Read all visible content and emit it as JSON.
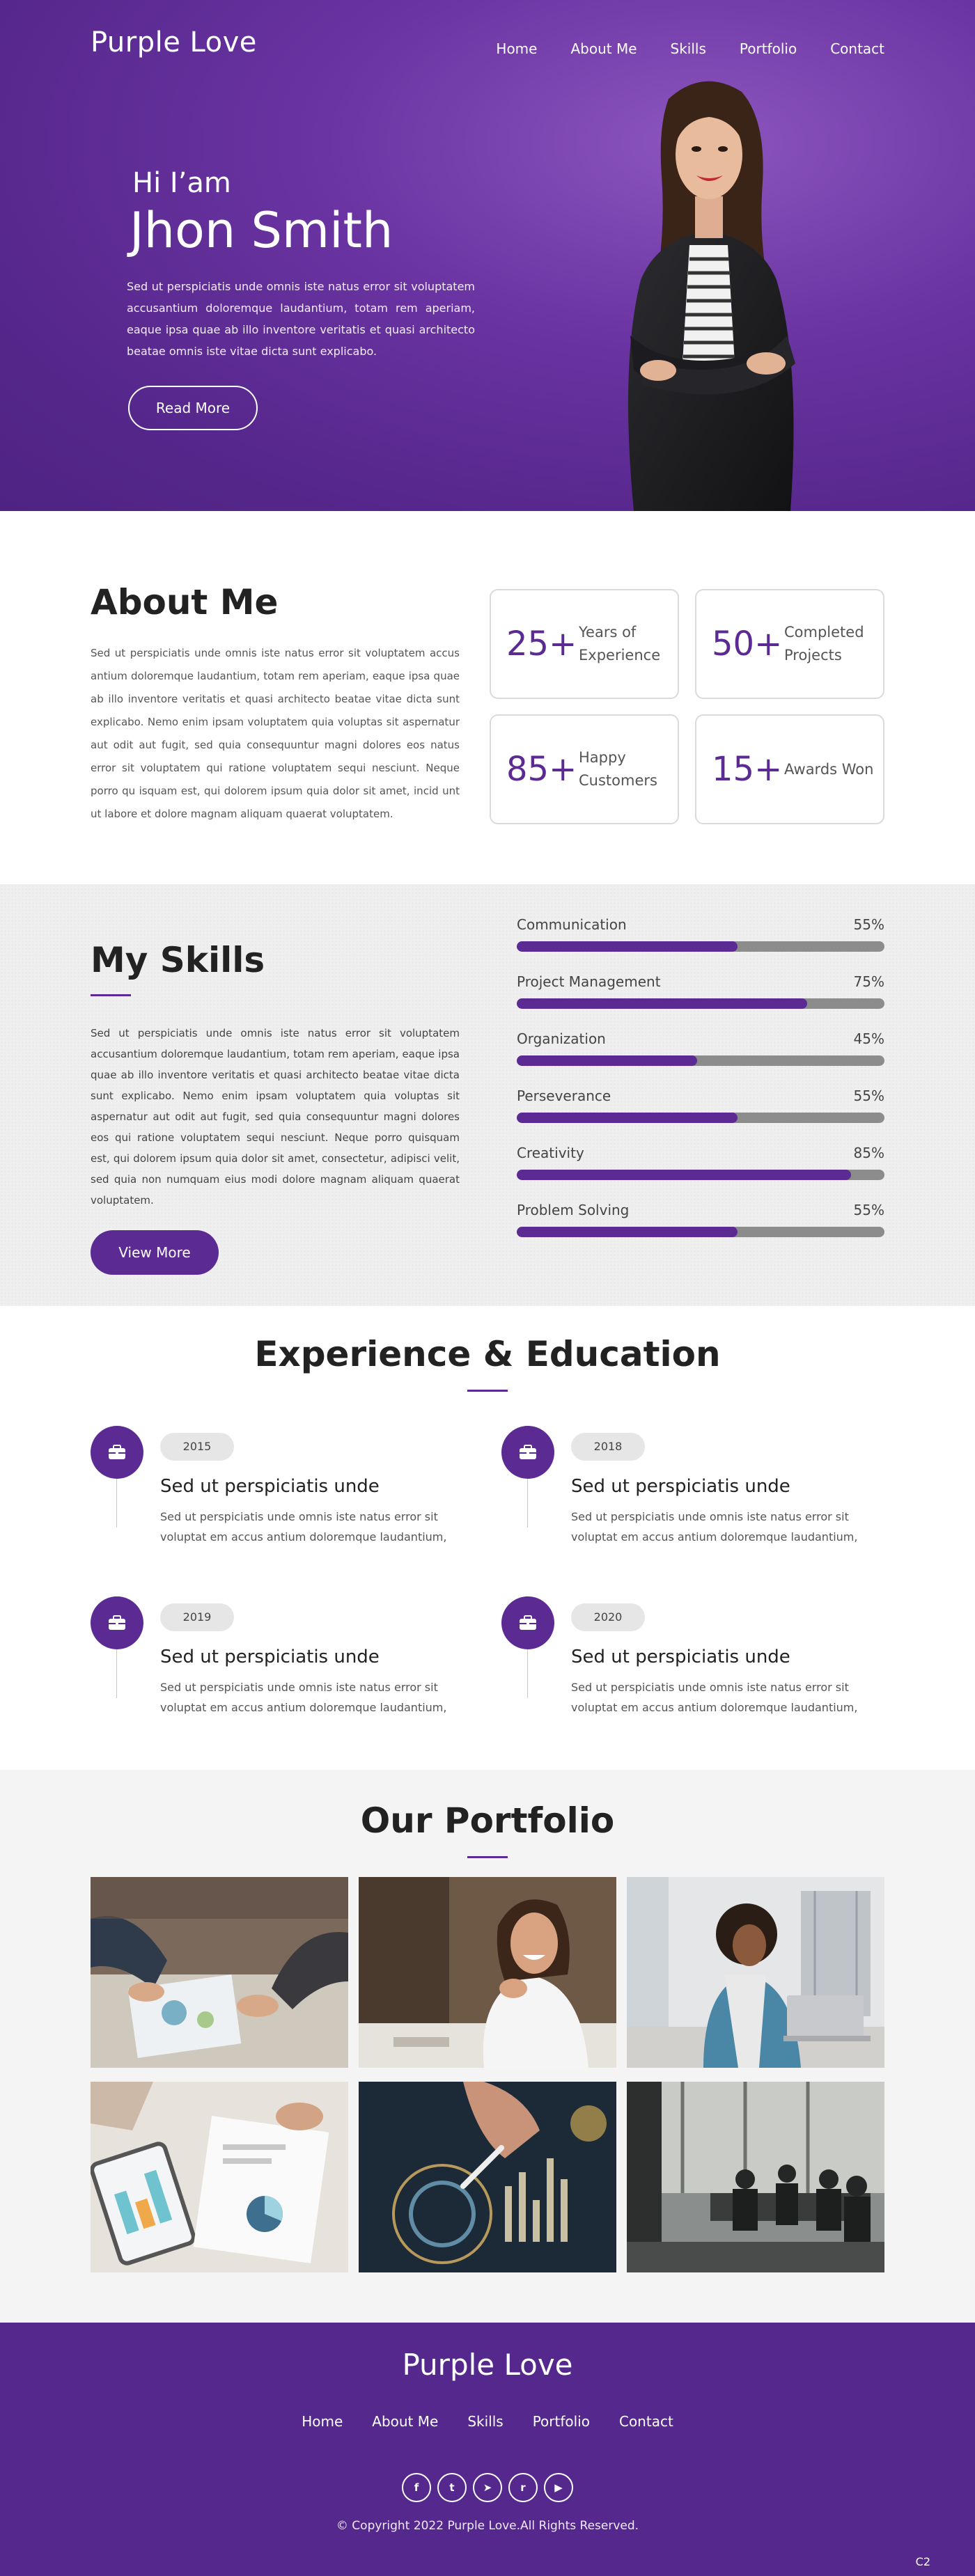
{
  "brand": {
    "name": "Purple Love"
  },
  "nav": {
    "items": [
      {
        "label": "Home"
      },
      {
        "label": "About Me"
      },
      {
        "label": "Skills"
      },
      {
        "label": "Portfolio"
      },
      {
        "label": "Contact"
      }
    ]
  },
  "hero": {
    "greeting": "Hi I’am",
    "name": "Jhon Smith",
    "description": "Sed ut perspiciatis unde omnis iste natus error sit voluptatem accusantium doloremque laudantium, totam rem aperiam, eaque ipsa quae ab illo inventore veritatis et quasi architecto beatae omnis iste  vitae dicta sunt explicabo.",
    "button_label": "Read More"
  },
  "about": {
    "title": "About Me",
    "description": "Sed ut perspiciatis unde omnis iste natus error sit voluptatem accus antium doloremque laudantium, totam rem aperiam, eaque ipsa quae ab illo inventore veritatis et quasi architecto beatae vitae dicta sunt explicabo. Nemo enim ipsam voluptatem quia voluptas sit aspernatur aut odit aut fugit, sed quia consequuntur magni dolores eos natus error sit voluptatem qui ratione voluptatem sequi nesciunt. Neque porro qu isquam est, qui dolorem ipsum quia dolor sit amet,  incid unt ut labore et dolore magnam aliquam quaerat voluptatem.",
    "stats": [
      {
        "value": "25+",
        "label": "Years of Experience"
      },
      {
        "value": "50+",
        "label": "Completed Projects"
      },
      {
        "value": "85+",
        "label": "Happy Customers"
      },
      {
        "value": "15+",
        "label": "Awards Won"
      }
    ]
  },
  "skills": {
    "title": "My Skills",
    "description": "Sed ut perspiciatis unde omnis iste natus error sit voluptatem accusantium doloremque laudantium, totam rem aperiam, eaque ipsa quae ab illo inventore veritatis et quasi architecto beatae vitae dicta sunt explicabo. Nemo enim ipsam voluptatem quia voluptas sit aspernatur aut odit aut fugit, sed quia consequuntur magni dolores eos qui ratione voluptatem sequi nesciunt. Neque porro quisquam est, qui dolorem ipsum quia dolor sit amet, consectetur, adipisci velit, sed quia non numquam eius modi dolore magnam aliquam quaerat voluptatem.",
    "button_label": "View More",
    "items": [
      {
        "name": "Communication",
        "percent_label": "55%",
        "value": 0.6
      },
      {
        "name": "Project Management",
        "percent_label": "75%",
        "value": 0.79
      },
      {
        "name": "Organization",
        "percent_label": "45%",
        "value": 0.49
      },
      {
        "name": "Perseverance",
        "percent_label": "55%",
        "value": 0.6
      },
      {
        "name": "Creativity",
        "percent_label": "85%",
        "value": 0.91
      },
      {
        "name": "Problem Solving",
        "percent_label": "55%",
        "value": 0.6
      }
    ]
  },
  "experience": {
    "title": "Experience & Education",
    "items": [
      {
        "year": "2015",
        "title": "Sed ut perspiciatis unde",
        "description": "Sed ut perspiciatis unde omnis iste natus error sit voluptat em accus antium doloremque laudantium,"
      },
      {
        "year": "2018",
        "title": "Sed ut perspiciatis unde",
        "description": "Sed ut perspiciatis unde omnis iste natus error sit voluptat em accus antium doloremque laudantium,"
      },
      {
        "year": "2019",
        "title": "Sed ut perspiciatis unde",
        "description": "Sed ut perspiciatis unde omnis iste natus error sit voluptat em accus antium doloremque laudantium,"
      },
      {
        "year": "2020",
        "title": "Sed ut perspiciatis unde",
        "description": "Sed ut perspiciatis unde omnis iste natus error sit voluptat em accus antium doloremque laudantium,"
      }
    ]
  },
  "portfolio": {
    "title": "Our Portfolio"
  },
  "footer": {
    "brand": "Purple Love",
    "nav": [
      {
        "label": "Home"
      },
      {
        "label": "About Me"
      },
      {
        "label": "Skills"
      },
      {
        "label": "Portfolio"
      },
      {
        "label": "Contact"
      }
    ],
    "socials": [
      {
        "icon": "facebook-icon",
        "glyph": "f"
      },
      {
        "icon": "twitter-icon",
        "glyph": "t"
      },
      {
        "icon": "telegram-icon",
        "glyph": "➤"
      },
      {
        "icon": "reddit-icon",
        "glyph": "r"
      },
      {
        "icon": "youtube-icon",
        "glyph": "▶"
      }
    ],
    "copyright": "© Copyright 2022 Purple Love.All Rights Reserved.",
    "corner_tag": "C2"
  },
  "colors": {
    "accent": "#5b2a92",
    "hero_bg": "#5f2d96",
    "footer_bg": "#54288d",
    "bar_track": "#8c8c8c"
  }
}
